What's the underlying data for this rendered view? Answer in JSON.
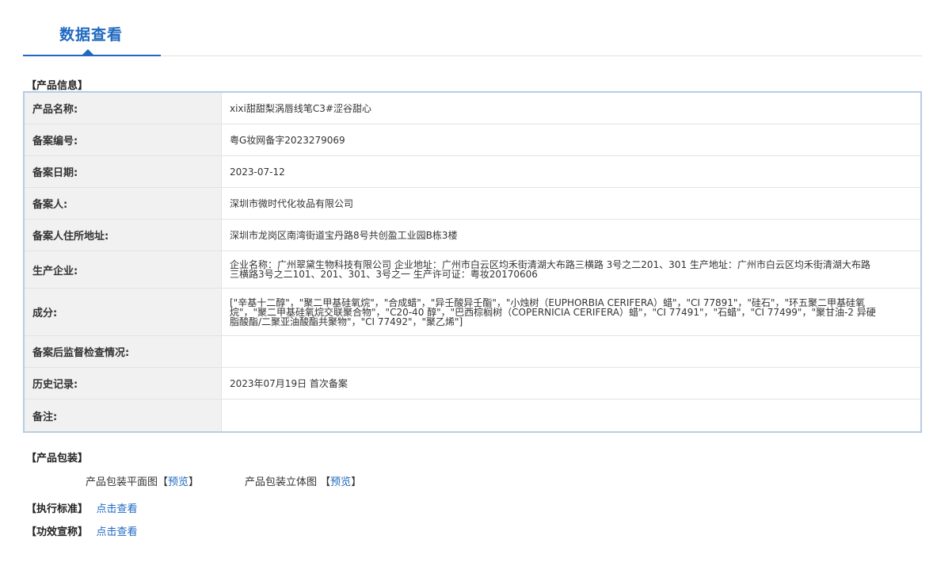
{
  "header": {
    "title": "数据查看"
  },
  "sections": {
    "product_info": "【产品信息】",
    "packaging": "【产品包装】",
    "standard": "【执行标准】",
    "efficacy": "【功效宣称】"
  },
  "product_rows": [
    {
      "label": "产品名称:",
      "value": "xixi甜甜梨涡唇线笔C3#涩谷甜心"
    },
    {
      "label": "备案编号:",
      "value": "粤G妆网备字2023279069"
    },
    {
      "label": "备案日期:",
      "value": "2023-07-12"
    },
    {
      "label": "备案人:",
      "value": "深圳市微时代化妆品有限公司"
    },
    {
      "label": "备案人住所地址:",
      "value": "深圳市龙岗区南湾街道宝丹路8号共创盈工业园B栋3楼"
    },
    {
      "label": "生产企业:",
      "value": "企业名称：广州翠黛生物科技有限公司 企业地址：广州市白云区均禾街清湖大布路三横路 3号之二201、301 生产地址：广州市白云区均禾街清湖大布路三横路3号之二101、201、301、3号之一 生产许可证：粤妆20170606"
    },
    {
      "label": "成分:",
      "value": "[\"辛基十二醇\"，\"聚二甲基硅氧烷\"，\"合成蜡\"，\"异壬酸异壬酯\"，\"小烛树（EUPHORBIA CERIFERA）蜡\"，\"CI 77891\"，\"硅石\"，\"环五聚二甲基硅氧烷\"，\"聚二甲基硅氧烷交联聚合物\"，\"C20-40 醇\"，\"巴西棕榈树（COPERNICIA CERIFERA）蜡\"，\"CI 77491\"，\"石蜡\"，\"CI 77499\"，\"聚甘油-2 异硬脂酸酯/二聚亚油酸酯共聚物\"，\"CI 77492\"，\"聚乙烯\"]"
    },
    {
      "label": "备案后监督检查情况:",
      "value": ""
    },
    {
      "label": "历史记录:",
      "value": "2023年07月19日 首次备案"
    },
    {
      "label": "备注:",
      "value": ""
    }
  ],
  "packaging": {
    "flat_label": "产品包装平面图",
    "flat_open": "【",
    "flat_link": "预览",
    "flat_close": "】",
    "three_d_label": "产品包装立体图",
    "three_d_open": "【",
    "three_d_link": "预览",
    "three_d_close": "】"
  },
  "links": {
    "standard_link": "点击查看",
    "efficacy_link": "点击查看"
  },
  "colors": {
    "accent": "#1f69c0",
    "label_bg": "#f1f1f1",
    "table_border": "#b6cde3"
  }
}
